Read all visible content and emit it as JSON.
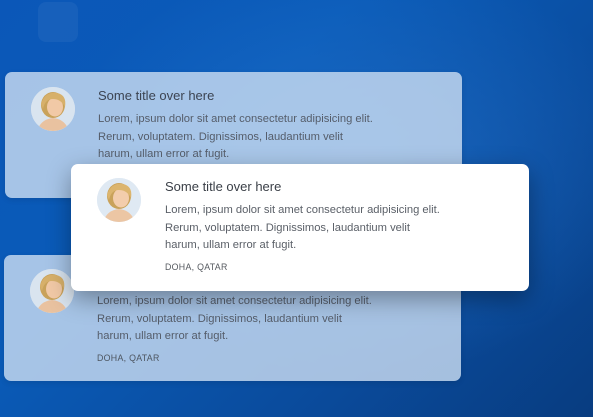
{
  "cards": [
    {
      "title": "Some title over here",
      "lines": [
        "Lorem, ipsum dolor sit amet consectetur adipisicing elit.",
        "Rerum, voluptatem. Dignissimos, laudantium velit",
        "harum, ullam error at fugit."
      ],
      "location": "",
      "avatar_icon": "woman-portrait-icon"
    },
    {
      "title": "Some title over here",
      "lines": [
        "Lorem, ipsum dolor sit amet consectetur adipisicing elit.",
        "Rerum, voluptatem. Dignissimos, laudantium velit",
        "harum, ullam error at fugit."
      ],
      "location": "DOHA, QATAR",
      "avatar_icon": "woman-portrait-icon"
    },
    {
      "title": "",
      "lines": [
        "Lorem, ipsum dolor sit amet consectetur adipisicing elit.",
        "Rerum, voluptatem. Dignissimos, laudantium velit",
        "harum, ullam error at fugit."
      ],
      "location": "DOHA, QATAR",
      "avatar_icon": "woman-portrait-icon"
    }
  ],
  "colors": {
    "background": "#0a5bb8",
    "card_front": "#ffffff",
    "card_back": "#cddef2"
  }
}
